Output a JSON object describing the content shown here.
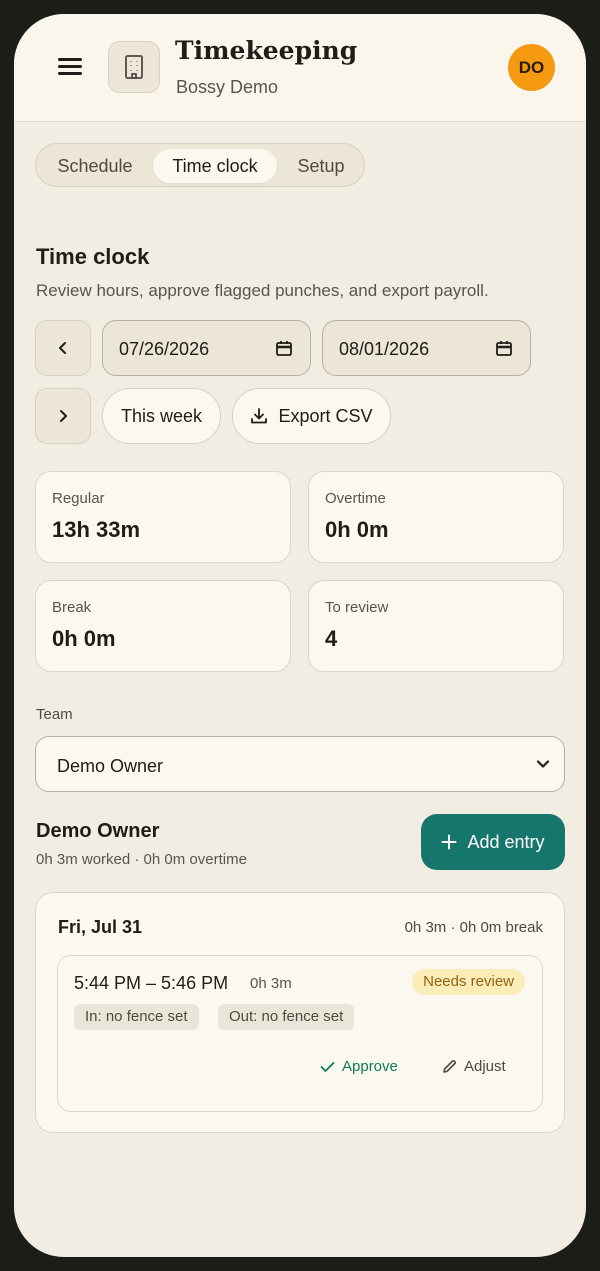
{
  "header": {
    "title": "Timekeeping",
    "subtitle": "Bossy Demo",
    "avatar_initials": "DO",
    "avatar_color": "#f59a10"
  },
  "tabs": [
    {
      "label": "Schedule",
      "active": false
    },
    {
      "label": "Time clock",
      "active": true
    },
    {
      "label": "Setup",
      "active": false
    }
  ],
  "section": {
    "title": "Time clock",
    "description": "Review hours, approve flagged punches, and export payroll."
  },
  "range": {
    "start_date": "07/26/2026",
    "end_date": "08/01/2026",
    "this_week_label": "This week",
    "export_label": "Export CSV"
  },
  "stats": [
    {
      "label": "Regular",
      "value": "13h 33m"
    },
    {
      "label": "Overtime",
      "value": "0h 0m"
    },
    {
      "label": "Break",
      "value": "0h 0m"
    },
    {
      "label": "To review",
      "value": "4"
    }
  ],
  "team": {
    "label": "Team",
    "selected": "Demo Owner"
  },
  "member": {
    "name": "Demo Owner",
    "summary": "0h 3m worked · 0h 0m overtime",
    "add_entry_label": "Add entry"
  },
  "day": {
    "title": "Fri, Jul 31",
    "summary": "0h 3m · 0h 0m break",
    "entry": {
      "time_range": "5:44 PM – 5:46 PM",
      "duration": "0h 3m",
      "status": "Needs review",
      "in_fence": "In: no fence set",
      "out_fence": "Out: no fence set",
      "approve_label": "Approve",
      "adjust_label": "Adjust"
    }
  },
  "colors": {
    "accent": "#17766b",
    "background": "#f2ede2",
    "review_badge_bg": "#fbedb8",
    "approve": "#137a52"
  }
}
